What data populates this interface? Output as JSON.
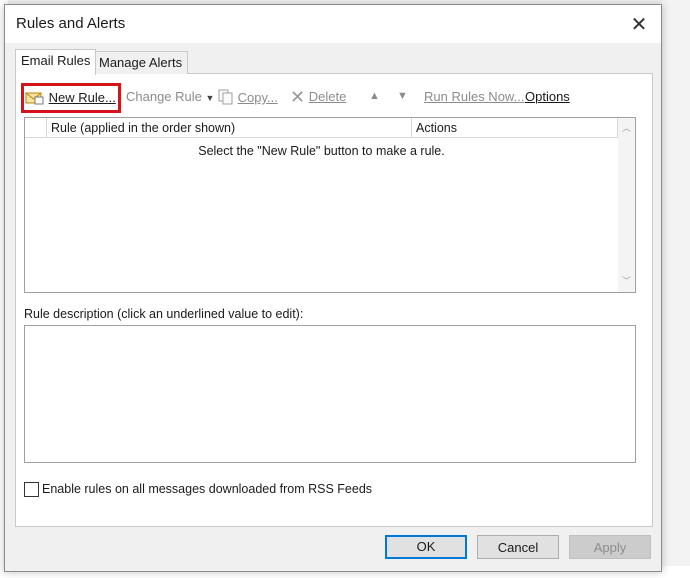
{
  "window": {
    "title": "Rules and Alerts"
  },
  "tabs": [
    {
      "label": "Email Rules",
      "active": true
    },
    {
      "label": "Manage Alerts",
      "active": false
    }
  ],
  "toolbar": {
    "new_rule": "New Rule...",
    "change_rule": "Change Rule",
    "copy": "Copy...",
    "delete": "Delete",
    "run_rules_now": "Run Rules Now...",
    "options": "Options"
  },
  "rules_list": {
    "columns": [
      "Rule (applied in the order shown)",
      "Actions"
    ],
    "empty_message": "Select the \"New Rule\" button to make a rule."
  },
  "description": {
    "label": "Rule description (click an underlined value to edit):"
  },
  "rss": {
    "label": "Enable rules on all messages downloaded from RSS Feeds",
    "checked": false
  },
  "buttons": {
    "ok": "OK",
    "cancel": "Cancel",
    "apply": "Apply"
  },
  "colors": {
    "highlight": "#d6121b",
    "default_button_border": "#0078d7"
  }
}
